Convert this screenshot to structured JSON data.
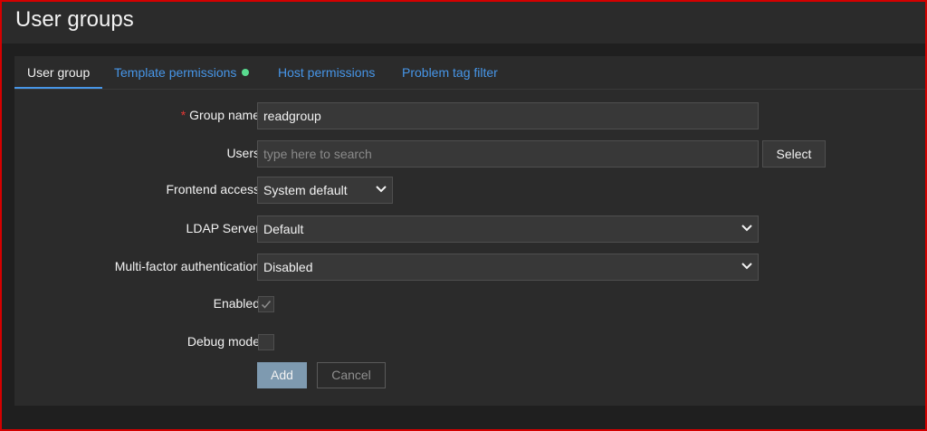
{
  "page": {
    "title": "User groups"
  },
  "tabs": [
    {
      "label": "User group",
      "active": true
    },
    {
      "label": "Template permissions",
      "indicator_color": "#59db8f"
    },
    {
      "label": "Host permissions"
    },
    {
      "label": "Problem tag filter"
    }
  ],
  "form": {
    "group_name": {
      "label": "Group name",
      "required_mark": "*",
      "value": "readgroup"
    },
    "users": {
      "label": "Users",
      "placeholder": "type here to search",
      "select_label": "Select"
    },
    "frontend_access": {
      "label": "Frontend access",
      "value": "System default"
    },
    "ldap_server": {
      "label": "LDAP Server",
      "value": "Default"
    },
    "mfa": {
      "label": "Multi-factor authentication",
      "value": "Disabled"
    },
    "enabled": {
      "label": "Enabled",
      "checked": true
    },
    "debug_mode": {
      "label": "Debug mode",
      "checked": false
    }
  },
  "buttons": {
    "add": "Add",
    "cancel": "Cancel"
  },
  "colors": {
    "link": "#4796e8",
    "required": "#e33734",
    "indicator": "#59db8f",
    "frame_border": "#d40000"
  }
}
